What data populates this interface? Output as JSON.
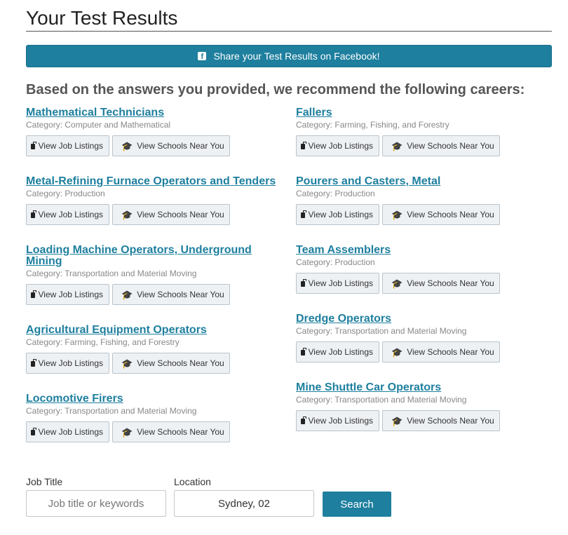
{
  "page": {
    "title": "Your Test Results"
  },
  "share": {
    "label": "Share your Test Results on Facebook!",
    "icon": "facebook-icon"
  },
  "recommend_heading": "Based on the answers you provided, we recommend the following careers:",
  "buttons": {
    "jobs_label": "View Job Listings",
    "schools_label": "View Schools Near You"
  },
  "careers_left": [
    {
      "title": "Mathematical Technicians",
      "category": "Category: Computer and Mathematical"
    },
    {
      "title": "Metal-Refining Furnace Operators and Tenders",
      "category": "Category: Production"
    },
    {
      "title": "Loading Machine Operators, Underground Mining",
      "category": "Category: Transportation and Material Moving"
    },
    {
      "title": "Agricultural Equipment Operators",
      "category": "Category: Farming, Fishing, and Forestry"
    },
    {
      "title": "Locomotive Firers",
      "category": "Category: Transportation and Material Moving"
    }
  ],
  "careers_right": [
    {
      "title": "Fallers",
      "category": "Category: Farming, Fishing, and Forestry"
    },
    {
      "title": "Pourers and Casters, Metal",
      "category": "Category: Production"
    },
    {
      "title": "Team Assemblers",
      "category": "Category: Production"
    },
    {
      "title": "Dredge Operators",
      "category": "Category: Transportation and Material Moving"
    },
    {
      "title": "Mine Shuttle Car Operators",
      "category": "Category: Transportation and Material Moving"
    }
  ],
  "search": {
    "job_title_label": "Job Title",
    "job_title_placeholder": "Job title or keywords",
    "job_title_value": "",
    "location_label": "Location",
    "location_value": "Sydney, 02",
    "button_label": "Search"
  },
  "colors": {
    "accent": "#1e7f9e",
    "button_bg": "#eef1f4",
    "category_text": "#888888"
  }
}
